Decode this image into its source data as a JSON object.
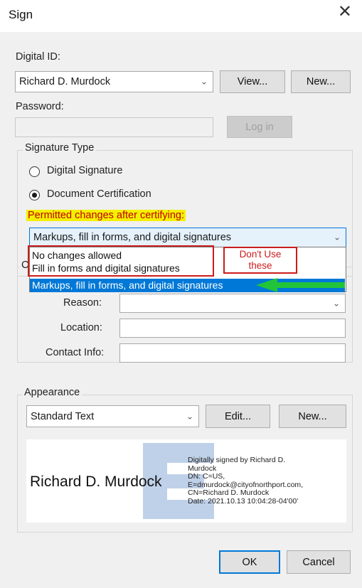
{
  "window": {
    "title": "Sign"
  },
  "digital_id": {
    "label": "Digital ID:",
    "selected": "Richard D. Murdock",
    "view_label": "View...",
    "new_label": "New..."
  },
  "password": {
    "label": "Password:",
    "value": "",
    "login_label": "Log in"
  },
  "signature_type": {
    "legend": "Signature Type",
    "options": [
      {
        "label": "Digital Signature",
        "selected": false
      },
      {
        "label": "Document Certification",
        "selected": true
      }
    ],
    "permitted_label": "Permitted changes after certifying:",
    "permitted_selected": "Markups, fill in forms, and digital signatures",
    "dropdown_options": [
      "No changes allowed",
      "Fill in forms and digital signatures",
      "Markups, fill in forms, and digital signatures"
    ],
    "annotation_line1": "Don't Use",
    "annotation_line2": "these"
  },
  "info": {
    "legend_partial": "C",
    "reason_label": "Reason:",
    "reason_value": "",
    "location_label": "Location:",
    "location_value": "",
    "contact_label": "Contact Info:",
    "contact_value": ""
  },
  "appearance": {
    "legend": "Appearance",
    "selected": "Standard Text",
    "edit_label": "Edit...",
    "new_label": "New...",
    "preview_name": "Richard D. Murdock",
    "preview_details": [
      "Digitally signed by Richard D.",
      "Murdock",
      "DN: C=US,",
      "E=dmurdock@cityofnorthport.com,",
      "CN=Richard D. Murdock",
      "Date: 2021.10.13 10:04:28-04'00'"
    ]
  },
  "footer": {
    "ok_label": "OK",
    "cancel_label": "Cancel"
  },
  "colors": {
    "highlight": "#f4f000",
    "annotation_red": "#cc1b1b",
    "selection_blue": "#0078d7",
    "arrow_green": "#22c43a"
  }
}
